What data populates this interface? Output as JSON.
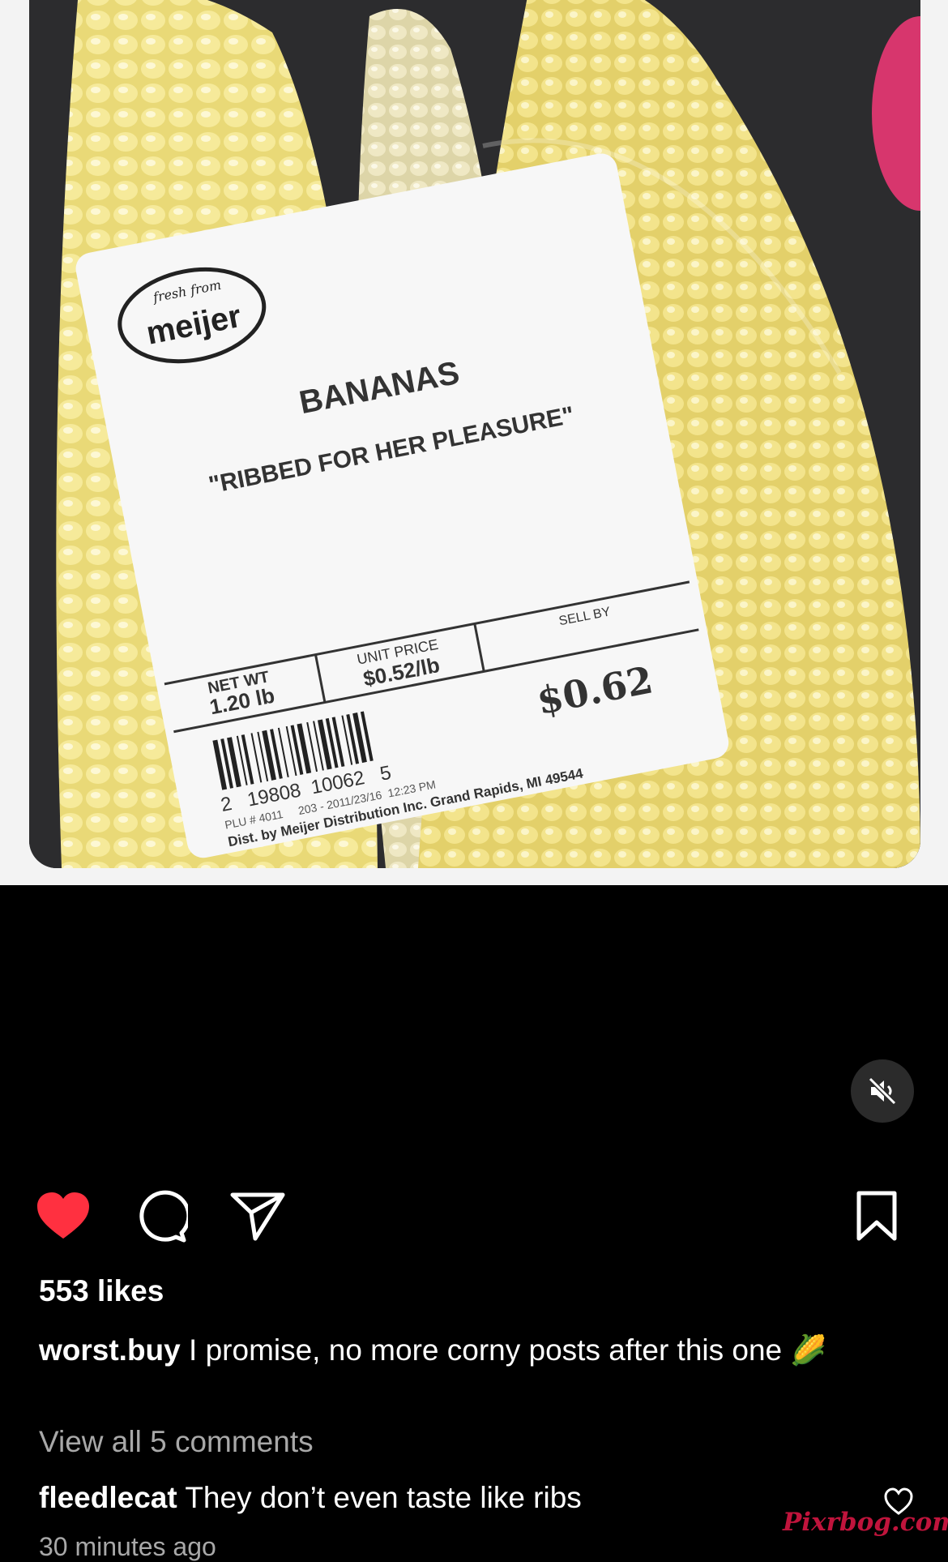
{
  "post_image": {
    "label": {
      "brand_small": "fresh from",
      "brand": "meijer",
      "product": "BANANAS",
      "tagline": "\"RIBBED FOR HER PLEASURE\"",
      "net_wt_label": "NET WT",
      "net_wt_value": "1.20 lb",
      "unit_price_label": "UNIT PRICE",
      "unit_price_value": "$0.52/lb",
      "sell_by_label": "SELL BY",
      "total_price": "$0.62",
      "barcode_digits": "2   19808  10062   5",
      "plu_line": "PLU # 4011     203 - 2011/23/16  12:23 PM",
      "distributor": "Dist. by Meijer Distribution Inc. Grand Rapids, MI 49544"
    }
  },
  "media_controls": {
    "mute_icon": "speaker-muted-icon"
  },
  "actions": {
    "like_icon": "heart-filled-icon",
    "comment_icon": "comment-bubble-icon",
    "share_icon": "paper-plane-icon",
    "save_icon": "bookmark-icon",
    "like_color": "#ff3040"
  },
  "likes": "553 likes",
  "caption": {
    "username": "worst.buy",
    "text": "I promise, no more corny posts after this one",
    "emoji": "🌽"
  },
  "view_all_comments": "View all 5 comments",
  "comment": {
    "username": "fleedlecat",
    "text": "They don’t even taste like ribs"
  },
  "timestamp": "30 minutes ago",
  "watermark": "Pixrbog.com"
}
